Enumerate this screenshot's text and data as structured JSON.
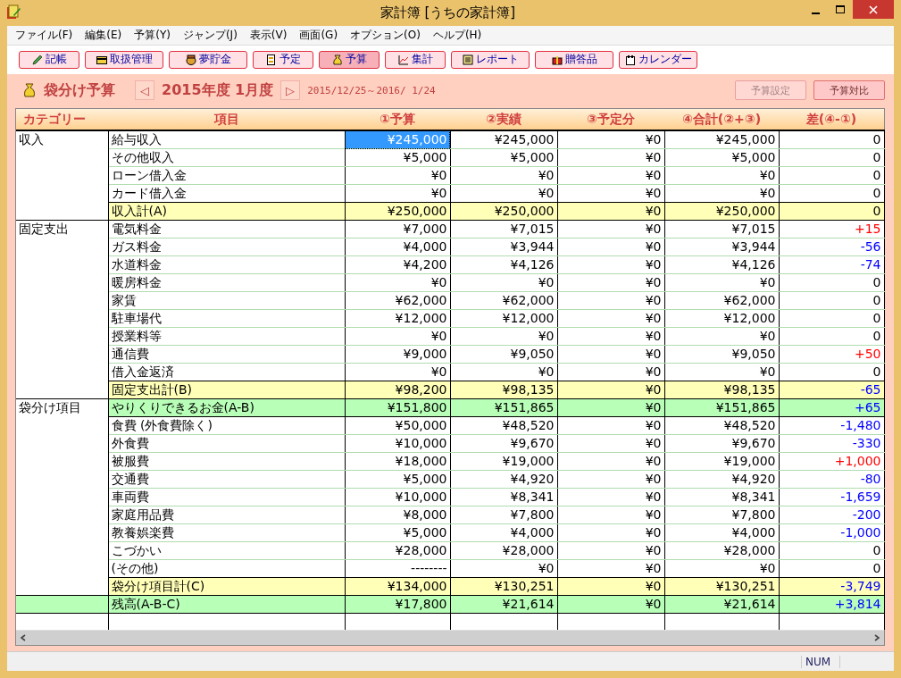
{
  "window": {
    "title": "家計簿 [うちの家計簿]"
  },
  "menu": [
    "ファイル(F)",
    "編集(E)",
    "予算(Y)",
    "ジャンプ(J)",
    "表示(V)",
    "画面(G)",
    "オプション(O)",
    "ヘルプ(H)"
  ],
  "toolbar": [
    {
      "kind": "pencil",
      "label": "記帳",
      "selected": false
    },
    {
      "kind": "card",
      "label": "取扱管理",
      "selected": false
    },
    {
      "kind": "pot",
      "label": "夢貯金",
      "selected": false
    },
    {
      "kind": "schedule",
      "label": "予定",
      "selected": false
    },
    {
      "kind": "bag",
      "label": "予算",
      "selected": true
    },
    {
      "kind": "chart",
      "label": "集計",
      "selected": false
    },
    {
      "kind": "list",
      "label": "レポート",
      "selected": false
    },
    {
      "kind": "gift",
      "label": "贈答品",
      "selected": false
    },
    {
      "kind": "calendar",
      "label": "カレンダー",
      "selected": false
    }
  ],
  "header": {
    "title": "袋分け予算",
    "period": "2015年度 1月度",
    "prev": "◁",
    "next": "▷",
    "range": "2015/12/25～2016/ 1/24",
    "buttons": [
      {
        "label": "予算設定",
        "disabled": true
      },
      {
        "label": "予算対比",
        "disabled": false
      }
    ]
  },
  "table": {
    "columns": [
      "カテゴリー",
      "項目",
      "①予算",
      "②実績",
      "③予定分",
      "④合計(②+③)",
      "差(④-①)"
    ],
    "groups": [
      {
        "category": "収入",
        "rows": [
          {
            "kind": "item",
            "item": "給与収入",
            "values": [
              "¥245,000",
              "¥245,000",
              "¥0",
              "¥245,000"
            ],
            "diff": "0",
            "color": "#000000",
            "selected": true
          },
          {
            "kind": "item",
            "item": "その他収入",
            "values": [
              "¥5,000",
              "¥5,000",
              "¥0",
              "¥5,000"
            ],
            "diff": "0",
            "color": "#000000",
            "selected": false
          },
          {
            "kind": "item",
            "item": "ローン借入金",
            "values": [
              "¥0",
              "¥0",
              "¥0",
              "¥0"
            ],
            "diff": "0",
            "color": "#000000",
            "selected": false
          },
          {
            "kind": "item",
            "item": "カード借入金",
            "values": [
              "¥0",
              "¥0",
              "¥0",
              "¥0"
            ],
            "diff": "0",
            "color": "#000000",
            "selected": false
          },
          {
            "kind": "subtotal",
            "item": "収入計(A)",
            "values": [
              "¥250,000",
              "¥250,000",
              "¥0",
              "¥250,000"
            ],
            "diff": "0",
            "color": "#000000",
            "selected": false
          }
        ]
      },
      {
        "category": "固定支出",
        "rows": [
          {
            "kind": "item",
            "item": "電気料金",
            "values": [
              "¥7,000",
              "¥7,015",
              "¥0",
              "¥7,015"
            ],
            "diff": "+15",
            "color": "#ff0000",
            "selected": false
          },
          {
            "kind": "item",
            "item": "ガス料金",
            "values": [
              "¥4,000",
              "¥3,944",
              "¥0",
              "¥3,944"
            ],
            "diff": "-56",
            "color": "#0000ff",
            "selected": false
          },
          {
            "kind": "item",
            "item": "水道料金",
            "values": [
              "¥4,200",
              "¥4,126",
              "¥0",
              "¥4,126"
            ],
            "diff": "-74",
            "color": "#0000ff",
            "selected": false
          },
          {
            "kind": "item",
            "item": "暖房料金",
            "values": [
              "¥0",
              "¥0",
              "¥0",
              "¥0"
            ],
            "diff": "0",
            "color": "#000000",
            "selected": false
          },
          {
            "kind": "item",
            "item": "家賃",
            "values": [
              "¥62,000",
              "¥62,000",
              "¥0",
              "¥62,000"
            ],
            "diff": "0",
            "color": "#000000",
            "selected": false
          },
          {
            "kind": "item",
            "item": "駐車場代",
            "values": [
              "¥12,000",
              "¥12,000",
              "¥0",
              "¥12,000"
            ],
            "diff": "0",
            "color": "#000000",
            "selected": false
          },
          {
            "kind": "item",
            "item": "授業料等",
            "values": [
              "¥0",
              "¥0",
              "¥0",
              "¥0"
            ],
            "diff": "0",
            "color": "#000000",
            "selected": false
          },
          {
            "kind": "item",
            "item": "通信費",
            "values": [
              "¥9,000",
              "¥9,050",
              "¥0",
              "¥9,050"
            ],
            "diff": "+50",
            "color": "#ff0000",
            "selected": false
          },
          {
            "kind": "item",
            "item": "借入金返済",
            "values": [
              "¥0",
              "¥0",
              "¥0",
              "¥0"
            ],
            "diff": "0",
            "color": "#000000",
            "selected": false
          },
          {
            "kind": "subtotal",
            "item": "固定支出計(B)",
            "values": [
              "¥98,200",
              "¥98,135",
              "¥0",
              "¥98,135"
            ],
            "diff": "-65",
            "color": "#0000ff",
            "selected": false
          }
        ]
      },
      {
        "category": "袋分け項目",
        "rows": [
          {
            "kind": "balance",
            "item": "やりくりできるお金(A-B)",
            "values": [
              "¥151,800",
              "¥151,865",
              "¥0",
              "¥151,865"
            ],
            "diff": "+65",
            "color": "#0000ff",
            "selected": false
          },
          {
            "kind": "item",
            "item": "食費 (外食費除く)",
            "values": [
              "¥50,000",
              "¥48,520",
              "¥0",
              "¥48,520"
            ],
            "diff": "-1,480",
            "color": "#0000ff",
            "selected": false
          },
          {
            "kind": "item",
            "item": "外食費",
            "values": [
              "¥10,000",
              "¥9,670",
              "¥0",
              "¥9,670"
            ],
            "diff": "-330",
            "color": "#0000ff",
            "selected": false
          },
          {
            "kind": "item",
            "item": "被服費",
            "values": [
              "¥18,000",
              "¥19,000",
              "¥0",
              "¥19,000"
            ],
            "diff": "+1,000",
            "color": "#ff0000",
            "selected": false
          },
          {
            "kind": "item",
            "item": "交通費",
            "values": [
              "¥5,000",
              "¥4,920",
              "¥0",
              "¥4,920"
            ],
            "diff": "-80",
            "color": "#0000ff",
            "selected": false
          },
          {
            "kind": "item",
            "item": "車両費",
            "values": [
              "¥10,000",
              "¥8,341",
              "¥0",
              "¥8,341"
            ],
            "diff": "-1,659",
            "color": "#0000ff",
            "selected": false
          },
          {
            "kind": "item",
            "item": "家庭用品費",
            "values": [
              "¥8,000",
              "¥7,800",
              "¥0",
              "¥7,800"
            ],
            "diff": "-200",
            "color": "#0000ff",
            "selected": false
          },
          {
            "kind": "item",
            "item": "教養娯楽費",
            "values": [
              "¥5,000",
              "¥4,000",
              "¥0",
              "¥4,000"
            ],
            "diff": "-1,000",
            "color": "#0000ff",
            "selected": false
          },
          {
            "kind": "item",
            "item": "こづかい",
            "values": [
              "¥28,000",
              "¥28,000",
              "¥0",
              "¥28,000"
            ],
            "diff": "0",
            "color": "#000000",
            "selected": false
          },
          {
            "kind": "item",
            "item": "(その他)",
            "values": [
              "--------",
              "¥0",
              "¥0",
              "¥0"
            ],
            "diff": "0",
            "color": "#000000",
            "selected": false
          },
          {
            "kind": "subtotal",
            "item": "袋分け項目計(C)",
            "values": [
              "¥134,000",
              "¥130,251",
              "¥0",
              "¥130,251"
            ],
            "diff": "-3,749",
            "color": "#0000ff",
            "selected": false
          }
        ]
      },
      {
        "rows": [
          {
            "kind": "balance",
            "item": "残高(A-B-C)",
            "values": [
              "¥17,800",
              "¥21,614",
              "¥0",
              "¥21,614"
            ],
            "diff": "+3,814",
            "color": "#0000ff",
            "selected": false
          }
        ]
      }
    ]
  },
  "status_bar": {
    "num": "NUM"
  }
}
